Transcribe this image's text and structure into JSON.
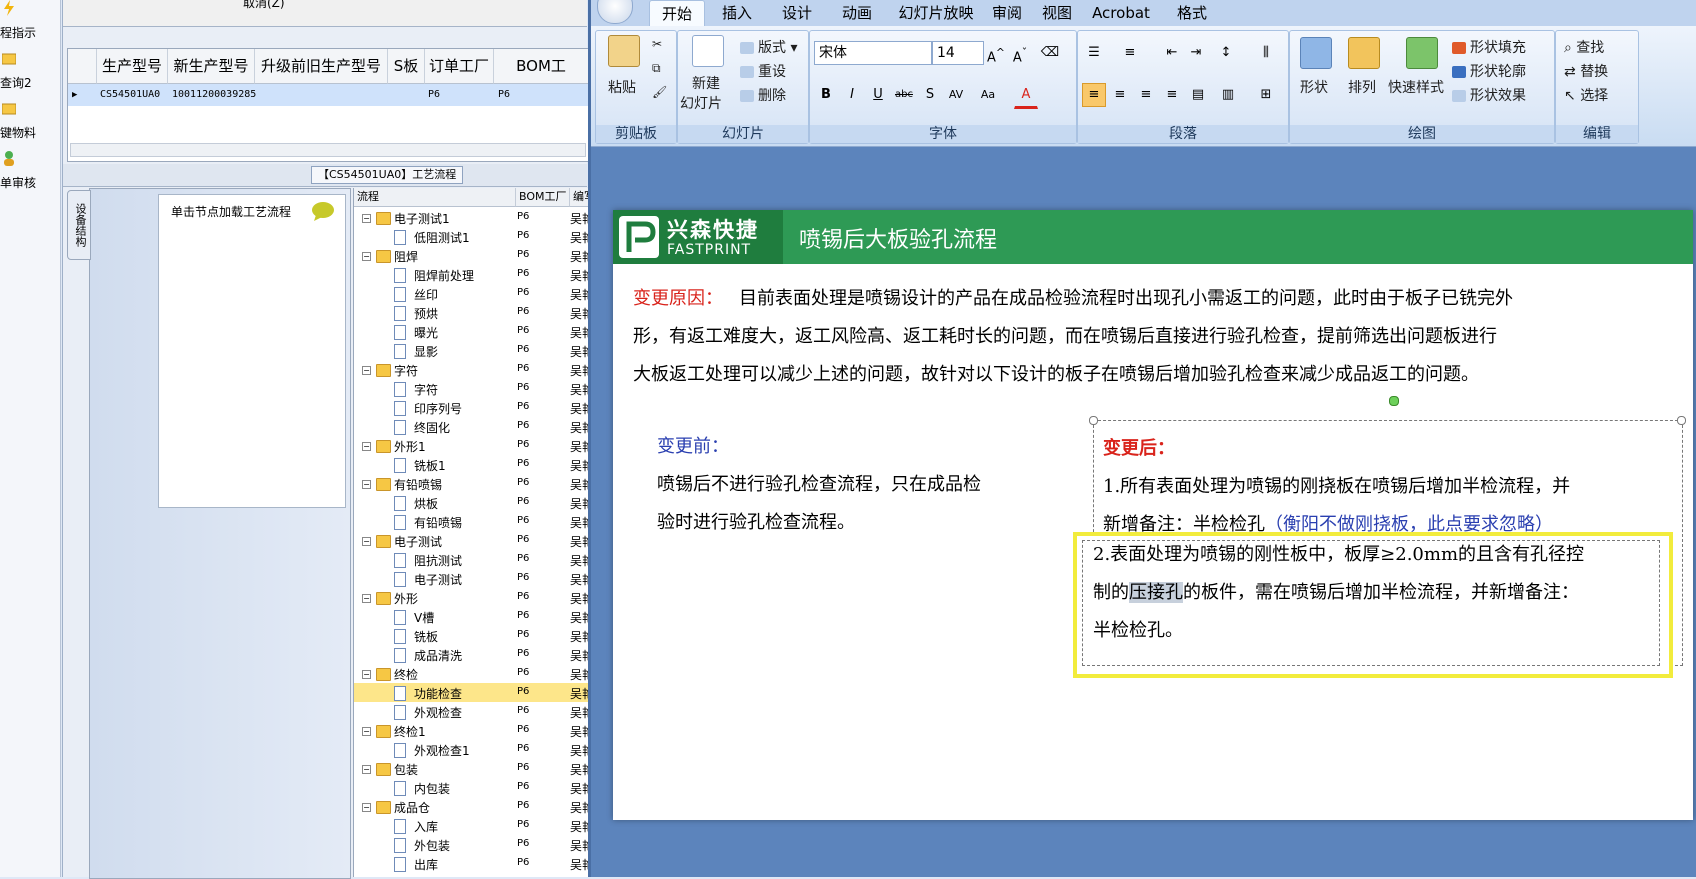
{
  "left_nav": {
    "items": [
      {
        "label": "程指示",
        "icon": "lightning-icon"
      },
      {
        "label": "查询2",
        "icon": "folder-icon"
      },
      {
        "label": "键物料",
        "icon": "folder-icon"
      },
      {
        "label": "单审核",
        "icon": "user-icon"
      }
    ]
  },
  "main_app": {
    "top_cancel_text": "取消(Z)",
    "grid": {
      "headers": [
        "生产型号",
        "新生产型号",
        "升级前旧生产型号",
        "S板",
        "订单工厂",
        "BOM工"
      ],
      "row": {
        "model": "CS54501UA0",
        "new_model": "10011200039285",
        "old_model": "",
        "s_board": "",
        "order_factory": "P6",
        "bom_factory": "P6"
      }
    },
    "mid_title": "【CS54501UA0】工艺流程",
    "vertical_tab": "设备结构",
    "load_hint": "单击节点加载工艺流程",
    "tree": {
      "headers": [
        "流程",
        "BOM工厂",
        "编写人"
      ],
      "rows": [
        {
          "label": "电子测试1",
          "type": "folder",
          "level": 1,
          "factory": "P6",
          "writer": "吴艳玲"
        },
        {
          "label": "低阻测试1",
          "type": "doc",
          "level": 2,
          "factory": "P6",
          "writer": "吴艳玲"
        },
        {
          "label": "阻焊",
          "type": "folder",
          "level": 1,
          "factory": "P6",
          "writer": "吴艳玲"
        },
        {
          "label": "阻焊前处理",
          "type": "doc",
          "level": 2,
          "factory": "P6",
          "writer": "吴艳玲"
        },
        {
          "label": "丝印",
          "type": "doc",
          "level": 2,
          "factory": "P6",
          "writer": "吴艳玲"
        },
        {
          "label": "预烘",
          "type": "doc",
          "level": 2,
          "factory": "P6",
          "writer": "吴艳玲"
        },
        {
          "label": "曝光",
          "type": "doc",
          "level": 2,
          "factory": "P6",
          "writer": "吴艳玲"
        },
        {
          "label": "显影",
          "type": "doc",
          "level": 2,
          "factory": "P6",
          "writer": "吴艳玲"
        },
        {
          "label": "字符",
          "type": "folder",
          "level": 1,
          "factory": "P6",
          "writer": "吴艳玲"
        },
        {
          "label": "字符",
          "type": "doc",
          "level": 2,
          "factory": "P6",
          "writer": "吴艳玲"
        },
        {
          "label": "印序列号",
          "type": "doc",
          "level": 2,
          "factory": "P6",
          "writer": "吴艳玲"
        },
        {
          "label": "终固化",
          "type": "doc",
          "level": 2,
          "factory": "P6",
          "writer": "吴艳玲"
        },
        {
          "label": "外形1",
          "type": "folder",
          "level": 1,
          "factory": "P6",
          "writer": "吴艳玲"
        },
        {
          "label": "铣板1",
          "type": "doc",
          "level": 2,
          "factory": "P6",
          "writer": "吴艳玲"
        },
        {
          "label": "有铅喷锡",
          "type": "folder",
          "level": 1,
          "factory": "P6",
          "writer": "吴艳玲"
        },
        {
          "label": "烘板",
          "type": "doc",
          "level": 2,
          "factory": "P6",
          "writer": "吴艳玲"
        },
        {
          "label": "有铅喷锡",
          "type": "doc",
          "level": 2,
          "factory": "P6",
          "writer": "吴艳玲"
        },
        {
          "label": "电子测试",
          "type": "folder",
          "level": 1,
          "factory": "P6",
          "writer": "吴艳玲"
        },
        {
          "label": "阻抗测试",
          "type": "doc",
          "level": 2,
          "factory": "P6",
          "writer": "吴艳玲"
        },
        {
          "label": "电子测试",
          "type": "doc",
          "level": 2,
          "factory": "P6",
          "writer": "吴艳玲"
        },
        {
          "label": "外形",
          "type": "folder",
          "level": 1,
          "factory": "P6",
          "writer": "吴艳玲"
        },
        {
          "label": "V槽",
          "type": "doc",
          "level": 2,
          "factory": "P6",
          "writer": "吴艳玲"
        },
        {
          "label": "铣板",
          "type": "doc",
          "level": 2,
          "factory": "P6",
          "writer": "吴艳玲"
        },
        {
          "label": "成品清洗",
          "type": "doc",
          "level": 2,
          "factory": "P6",
          "writer": "吴艳玲"
        },
        {
          "label": "终检",
          "type": "folder",
          "level": 1,
          "factory": "P6",
          "writer": "吴艳玲"
        },
        {
          "label": "功能检查",
          "type": "doc",
          "level": 2,
          "factory": "P6",
          "writer": "吴艳玲",
          "selected": true
        },
        {
          "label": "外观检查",
          "type": "doc",
          "level": 2,
          "factory": "P6",
          "writer": "吴艳玲"
        },
        {
          "label": "终检1",
          "type": "folder",
          "level": 1,
          "factory": "P6",
          "writer": "吴艳玲"
        },
        {
          "label": "外观检查1",
          "type": "doc",
          "level": 2,
          "factory": "P6",
          "writer": "吴艳玲"
        },
        {
          "label": "包装",
          "type": "folder",
          "level": 1,
          "factory": "P6",
          "writer": "吴艳玲"
        },
        {
          "label": "内包装",
          "type": "doc",
          "level": 2,
          "factory": "P6",
          "writer": "吴艳玲"
        },
        {
          "label": "成品仓",
          "type": "folder",
          "level": 1,
          "factory": "P6",
          "writer": "吴艳玲"
        },
        {
          "label": "入库",
          "type": "doc",
          "level": 2,
          "factory": "P6",
          "writer": "吴艳玲"
        },
        {
          "label": "外包装",
          "type": "doc",
          "level": 2,
          "factory": "P6",
          "writer": "吴艳玲"
        },
        {
          "label": "出库",
          "type": "doc",
          "level": 2,
          "factory": "P6",
          "writer": "吴艳玲"
        }
      ]
    }
  },
  "ppt": {
    "tabs": [
      "开始",
      "插入",
      "设计",
      "动画",
      "幻灯片放映",
      "审阅",
      "视图",
      "Acrobat",
      "格式"
    ],
    "active_tab": "开始",
    "groups": {
      "clipboard": {
        "label": "剪贴板",
        "paste": "粘贴"
      },
      "slides": {
        "label": "幻灯片",
        "new_slide_1": "新建",
        "new_slide_2": "幻灯片",
        "layout": "版式",
        "reset": "重设",
        "delete": "删除"
      },
      "font": {
        "label": "字体",
        "font_name": "宋体",
        "font_size": "14"
      },
      "paragraph": {
        "label": "段落"
      },
      "drawing": {
        "label": "绘图",
        "shapes": "形状",
        "arrange": "排列",
        "quick_styles": "快速样式",
        "shape_fill": "形状填充",
        "shape_outline": "形状轮廓",
        "shape_effects": "形状效果"
      },
      "editing": {
        "label": "编辑",
        "find": "查找",
        "replace": "替换",
        "select": "选择"
      }
    },
    "slide": {
      "logo_name": "兴森快捷",
      "logo_sub": "FASTPRINT",
      "title": "喷锡后大板验孔流程",
      "reason_label": "变更原因：",
      "reason_line1": "目前表面处理是喷锡设计的产品在成品检验流程时出现孔小需返工的问题，此时由于板子已铣完外",
      "reason_line2": "形，有返工难度大，返工风险高、返工耗时长的问题，而在喷锡后直接进行验孔检查，提前筛选出问题板进行",
      "reason_line3": "大板返工处理可以减少上述的问题，故针对以下设计的板子在喷锡后增加验孔检查来减少成品返工的问题。",
      "before_label": "变更前：",
      "before_line1": "喷锡后不进行验孔检查流程，只在成品检",
      "before_line2": "验时进行验孔检查流程。",
      "after_label": "变更后：",
      "after1_line1": "1.所有表面处理为喷锡的刚挠板在喷锡后增加半检流程，并",
      "after1_line2a": "新增备注：半检检孔",
      "after1_line2b": "（衡阳不做刚挠板，此点要求忽略）",
      "after2_line1": "2.表面处理为喷锡的刚性板中，板厚≥2.0mm的且含有孔径控",
      "after2_line2a": "制的",
      "after2_line2b": "压接孔",
      "after2_line2c": "的板件，需在喷锡后增加半检流程，并新增备注：",
      "after2_line3": "半检检孔。"
    }
  },
  "colors": {
    "accent_green": "#2e9a55",
    "highlight_yellow": "#f2ec3c",
    "reason_red": "#d9241c",
    "before_blue": "#2a3fb0",
    "selected_row": "#fde68a"
  }
}
